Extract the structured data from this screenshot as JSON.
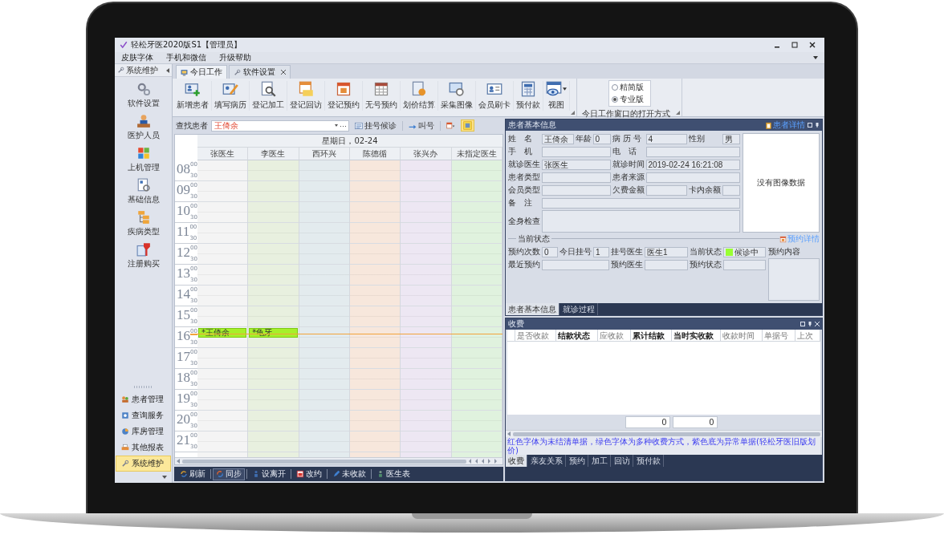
{
  "window": {
    "title": "轻松牙医2020版S1【管理员】"
  },
  "menu": [
    {
      "label": "皮肤字体"
    },
    {
      "label": "手机和微信"
    },
    {
      "label": "升级帮助"
    }
  ],
  "sidebar": {
    "title": "系统维护",
    "items": [
      {
        "label": "软件设置",
        "kind": "gears"
      },
      {
        "label": "医护人员",
        "kind": "person"
      },
      {
        "label": "上机管理",
        "kind": "tiles"
      },
      {
        "label": "基础信息",
        "kind": "doc-gear"
      },
      {
        "label": "疾病类型",
        "kind": "tree"
      },
      {
        "label": "注册购买",
        "kind": "doc-tag"
      }
    ],
    "nav": [
      {
        "label": "患者管理",
        "kind": "people",
        "selected": false
      },
      {
        "label": "查询服务",
        "kind": "search-doc",
        "selected": false
      },
      {
        "label": "库房管理",
        "kind": "pie",
        "selected": false
      },
      {
        "label": "其他报表",
        "kind": "printer",
        "selected": false
      },
      {
        "label": "系统维护",
        "kind": "wrench",
        "selected": true
      }
    ]
  },
  "tabs": [
    {
      "label": "今日工作",
      "kind": "monitor",
      "selected": true,
      "closable": false
    },
    {
      "label": "软件设置",
      "kind": "wrench",
      "selected": false,
      "closable": true
    }
  ],
  "ribbon": {
    "buttons": [
      {
        "label": "新增患者",
        "kind": "card-plus",
        "dropdown": false
      },
      {
        "label": "填写病历",
        "kind": "card-pencil",
        "dropdown": false
      },
      {
        "label": "登记加工",
        "kind": "doc-magnifier",
        "dropdown": false
      },
      {
        "label": "登记回访",
        "kind": "calendar-folder",
        "dropdown": false
      },
      {
        "label": "登记预约",
        "kind": "calendar",
        "dropdown": false
      },
      {
        "label": "无号预约",
        "kind": "table",
        "dropdown": false
      },
      {
        "label": "划价结算",
        "kind": "doc-coin",
        "dropdown": false
      },
      {
        "label": "采集图像",
        "kind": "image-gear",
        "dropdown": false
      },
      {
        "label": "会员刷卡",
        "kind": "card",
        "dropdown": false
      },
      {
        "label": "预付款",
        "kind": "calculator",
        "dropdown": false
      },
      {
        "label": "视图",
        "kind": "eye-window",
        "dropdown": true
      }
    ],
    "mode": {
      "options": [
        {
          "label": "精简版",
          "selected": false
        },
        {
          "label": "专业版",
          "selected": true
        }
      ],
      "caption": "今日工作窗口的打开方式"
    }
  },
  "search": {
    "label": "查找患者",
    "value": "王倚余",
    "actions": [
      {
        "label": "挂号候诊",
        "kind": "list"
      },
      {
        "label": "叫号",
        "kind": "arrow"
      }
    ],
    "tools": [
      {
        "kind": "calendar-drop",
        "active": false
      },
      {
        "kind": "photo",
        "active": true
      }
    ]
  },
  "calendar": {
    "header": "星期日，02-24",
    "columns": [
      {
        "name": "张医生",
        "color": "#f4f4f4"
      },
      {
        "name": "李医生",
        "color": "#e8f0df"
      },
      {
        "name": "西环兴",
        "color": "#e3ebee"
      },
      {
        "name": "陈德循",
        "color": "#f7e7dc"
      },
      {
        "name": "张兴办",
        "color": "#ede7f3"
      },
      {
        "name": "未指定医生",
        "color": "#e0f2de"
      }
    ],
    "hours": [
      {
        "hour": "08",
        "marks": [
          "00",
          "30"
        ],
        "now": false
      },
      {
        "hour": "09",
        "marks": [
          "00",
          "30"
        ],
        "now": false
      },
      {
        "hour": "10",
        "marks": [
          "00",
          "30"
        ],
        "now": false
      },
      {
        "hour": "11",
        "marks": [
          "00",
          "30"
        ],
        "now": false
      },
      {
        "hour": "12",
        "marks": [
          "00",
          "30"
        ],
        "now": false
      },
      {
        "hour": "13",
        "marks": [
          "00",
          "30"
        ],
        "now": false
      },
      {
        "hour": "14",
        "marks": [
          "00",
          "30"
        ],
        "now": false
      },
      {
        "hour": "15",
        "marks": [
          "00",
          "30"
        ],
        "now": false
      },
      {
        "hour": "16",
        "marks": [
          "00",
          "30"
        ],
        "now": true,
        "appointments": [
          {
            "label": "*王倚余"
          },
          {
            "label": "*龟牙"
          }
        ]
      },
      {
        "hour": "17",
        "marks": [
          "00",
          "30"
        ],
        "now": false
      },
      {
        "hour": "18",
        "marks": [
          "00",
          "30"
        ],
        "now": false
      },
      {
        "hour": "19",
        "marks": [
          "00",
          "30"
        ],
        "now": false
      },
      {
        "hour": "20",
        "marks": [
          "00",
          "30"
        ],
        "now": false
      },
      {
        "hour": "21",
        "marks": [
          "00",
          "30"
        ],
        "now": false
      }
    ]
  },
  "bottom_bar": [
    {
      "label": "刷新",
      "kind": "refresh",
      "pressed": false
    },
    {
      "label": "同步",
      "kind": "sync",
      "pressed": true
    },
    {
      "label": "设离开",
      "kind": "person-blue",
      "pressed": false
    },
    {
      "label": "改约",
      "kind": "calendar-red",
      "pressed": false
    },
    {
      "label": "未收款",
      "kind": "pencil",
      "pressed": false
    },
    {
      "label": "医生表",
      "kind": "doctor",
      "pressed": false
    }
  ],
  "patient": {
    "title": "患者基本信息",
    "link": "患者详情",
    "fields": [
      {
        "label": "姓　名",
        "value": "王倚余"
      },
      {
        "label": "年龄",
        "value": "0"
      },
      {
        "label": "病 历 号",
        "value": "4"
      },
      {
        "label": "性别",
        "value": "男"
      },
      {
        "label": "手　机"
      },
      {
        "label": "电　话"
      },
      {
        "label": "就诊医生",
        "value": "张医生"
      },
      {
        "label": "就诊时间",
        "value": "2019-02-24 16:21:08"
      },
      {
        "label": "患者类型"
      },
      {
        "label": "患者来源"
      },
      {
        "label": "会员类型"
      },
      {
        "label": "欠费金额"
      },
      {
        "label": "卡内余额"
      },
      {
        "label": "备　注"
      },
      {
        "label": "全身检查"
      }
    ],
    "photo_note": "没有图像数据",
    "status": {
      "title": "当前状态",
      "link": "预约详情",
      "fields": [
        {
          "label": "预约次数",
          "value": "0"
        },
        {
          "label": "今日挂号",
          "value": "1"
        },
        {
          "label": "挂号医生",
          "value": "医生1"
        },
        {
          "label": "当前状态",
          "value": "候诊中",
          "color": "#99ff33"
        },
        {
          "label": "最近预约"
        },
        {
          "label": "预约医生"
        },
        {
          "label": "预约状态"
        }
      ],
      "content_label": "预约内容"
    },
    "tabs": [
      {
        "label": "患者基本信息",
        "selected": true
      },
      {
        "label": "就诊过程",
        "selected": false
      }
    ]
  },
  "fees": {
    "title": "收费",
    "columns": [
      {
        "label": "是否收款",
        "bold": false
      },
      {
        "label": "结款状态",
        "bold": true
      },
      {
        "label": "应收款",
        "bold": false
      },
      {
        "label": "累计结款",
        "bold": true
      },
      {
        "label": "当时实收款",
        "bold": true
      },
      {
        "label": "收款时间",
        "bold": false
      },
      {
        "label": "单据号",
        "bold": false
      },
      {
        "label": "上次",
        "bold": false
      }
    ],
    "totals": [
      "0",
      "0"
    ],
    "note": "红色字体为未结清单据，绿色字体为多种收费方式，紫色底为异常单据(轻松牙医旧版划价)",
    "tabs": [
      {
        "label": "收费",
        "selected": true
      },
      {
        "label": "亲友关系",
        "selected": false
      },
      {
        "label": "预约",
        "selected": false
      },
      {
        "label": "加工",
        "selected": false
      },
      {
        "label": "回访",
        "selected": false
      },
      {
        "label": "预付款",
        "selected": false
      }
    ]
  }
}
